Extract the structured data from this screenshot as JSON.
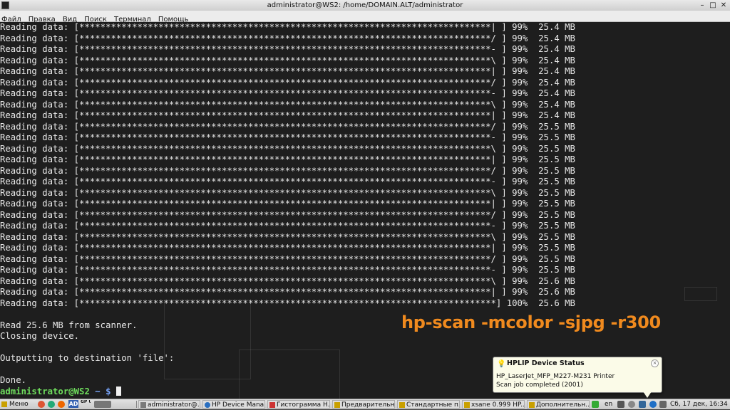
{
  "window": {
    "title": "administrator@WS2: /home/DOMAIN.ALT/administrator",
    "minimize": "–",
    "maximize": "□",
    "close": "✕"
  },
  "menu": [
    "Файл",
    "Правка",
    "Вид",
    "Поиск",
    "Терминал",
    "Помощь"
  ],
  "terminal": {
    "progress_lines": [
      "Reading data: [******************************************************************************| ] 99%  25.4 MB",
      "Reading data: [******************************************************************************/ ] 99%  25.4 MB",
      "Reading data: [******************************************************************************- ] 99%  25.4 MB",
      "Reading data: [******************************************************************************\\ ] 99%  25.4 MB",
      "Reading data: [******************************************************************************| ] 99%  25.4 MB",
      "Reading data: [******************************************************************************/ ] 99%  25.4 MB",
      "Reading data: [******************************************************************************- ] 99%  25.4 MB",
      "Reading data: [******************************************************************************\\ ] 99%  25.4 MB",
      "Reading data: [******************************************************************************| ] 99%  25.4 MB",
      "Reading data: [******************************************************************************/ ] 99%  25.5 MB",
      "Reading data: [******************************************************************************- ] 99%  25.5 MB",
      "Reading data: [******************************************************************************\\ ] 99%  25.5 MB",
      "Reading data: [******************************************************************************| ] 99%  25.5 MB",
      "Reading data: [******************************************************************************/ ] 99%  25.5 MB",
      "Reading data: [******************************************************************************- ] 99%  25.5 MB",
      "Reading data: [******************************************************************************\\ ] 99%  25.5 MB",
      "Reading data: [******************************************************************************| ] 99%  25.5 MB",
      "Reading data: [******************************************************************************/ ] 99%  25.5 MB",
      "Reading data: [******************************************************************************- ] 99%  25.5 MB",
      "Reading data: [******************************************************************************\\ ] 99%  25.5 MB",
      "Reading data: [******************************************************************************| ] 99%  25.5 MB",
      "Reading data: [******************************************************************************/ ] 99%  25.5 MB",
      "Reading data: [******************************************************************************- ] 99%  25.5 MB",
      "Reading data: [******************************************************************************\\ ] 99%  25.6 MB",
      "Reading data: [******************************************************************************| ] 99%  25.6 MB",
      "Reading data: [*******************************************************************************] 100%  25.6 MB"
    ],
    "read_line": "Read 25.6 MB from scanner.",
    "closing_line": "Closing device.",
    "output_line": "Outputting to destination 'file':",
    "done_line": "Done.",
    "prompt_user": "administrator@WS2",
    "prompt_path": "~",
    "prompt_symbol": "$"
  },
  "overlay_caption": "hp-scan -mcolor -sjpg -r300",
  "notification": {
    "title": "HPLIP Device Status",
    "device": "HP_LaserJet_MFP_M227-M231 Printer",
    "message": "Scan job completed (2001)",
    "icon": "lightbulb-icon"
  },
  "taskbar": {
    "menu_label": "Меню",
    "quick_launch": [
      "chrome-icon",
      "firefox-icon",
      "ad-icon",
      "gpu-icon",
      "terminal-icon"
    ],
    "quick_ad": "AD",
    "quick_gpu": "GP UI",
    "tasks": [
      "administrator@...",
      "HP Device Mana...",
      "Гистограмма Н...",
      "Предварительн...",
      "Стандартные п...",
      "xsane 0.999 HP...",
      "Дополнительн..."
    ],
    "lang": "en",
    "clock": "Сб, 17 дек, 16:34"
  },
  "colors": {
    "prompt": "#6fdd5d",
    "path": "#7aa7ff",
    "caption": "#f08a1e"
  }
}
